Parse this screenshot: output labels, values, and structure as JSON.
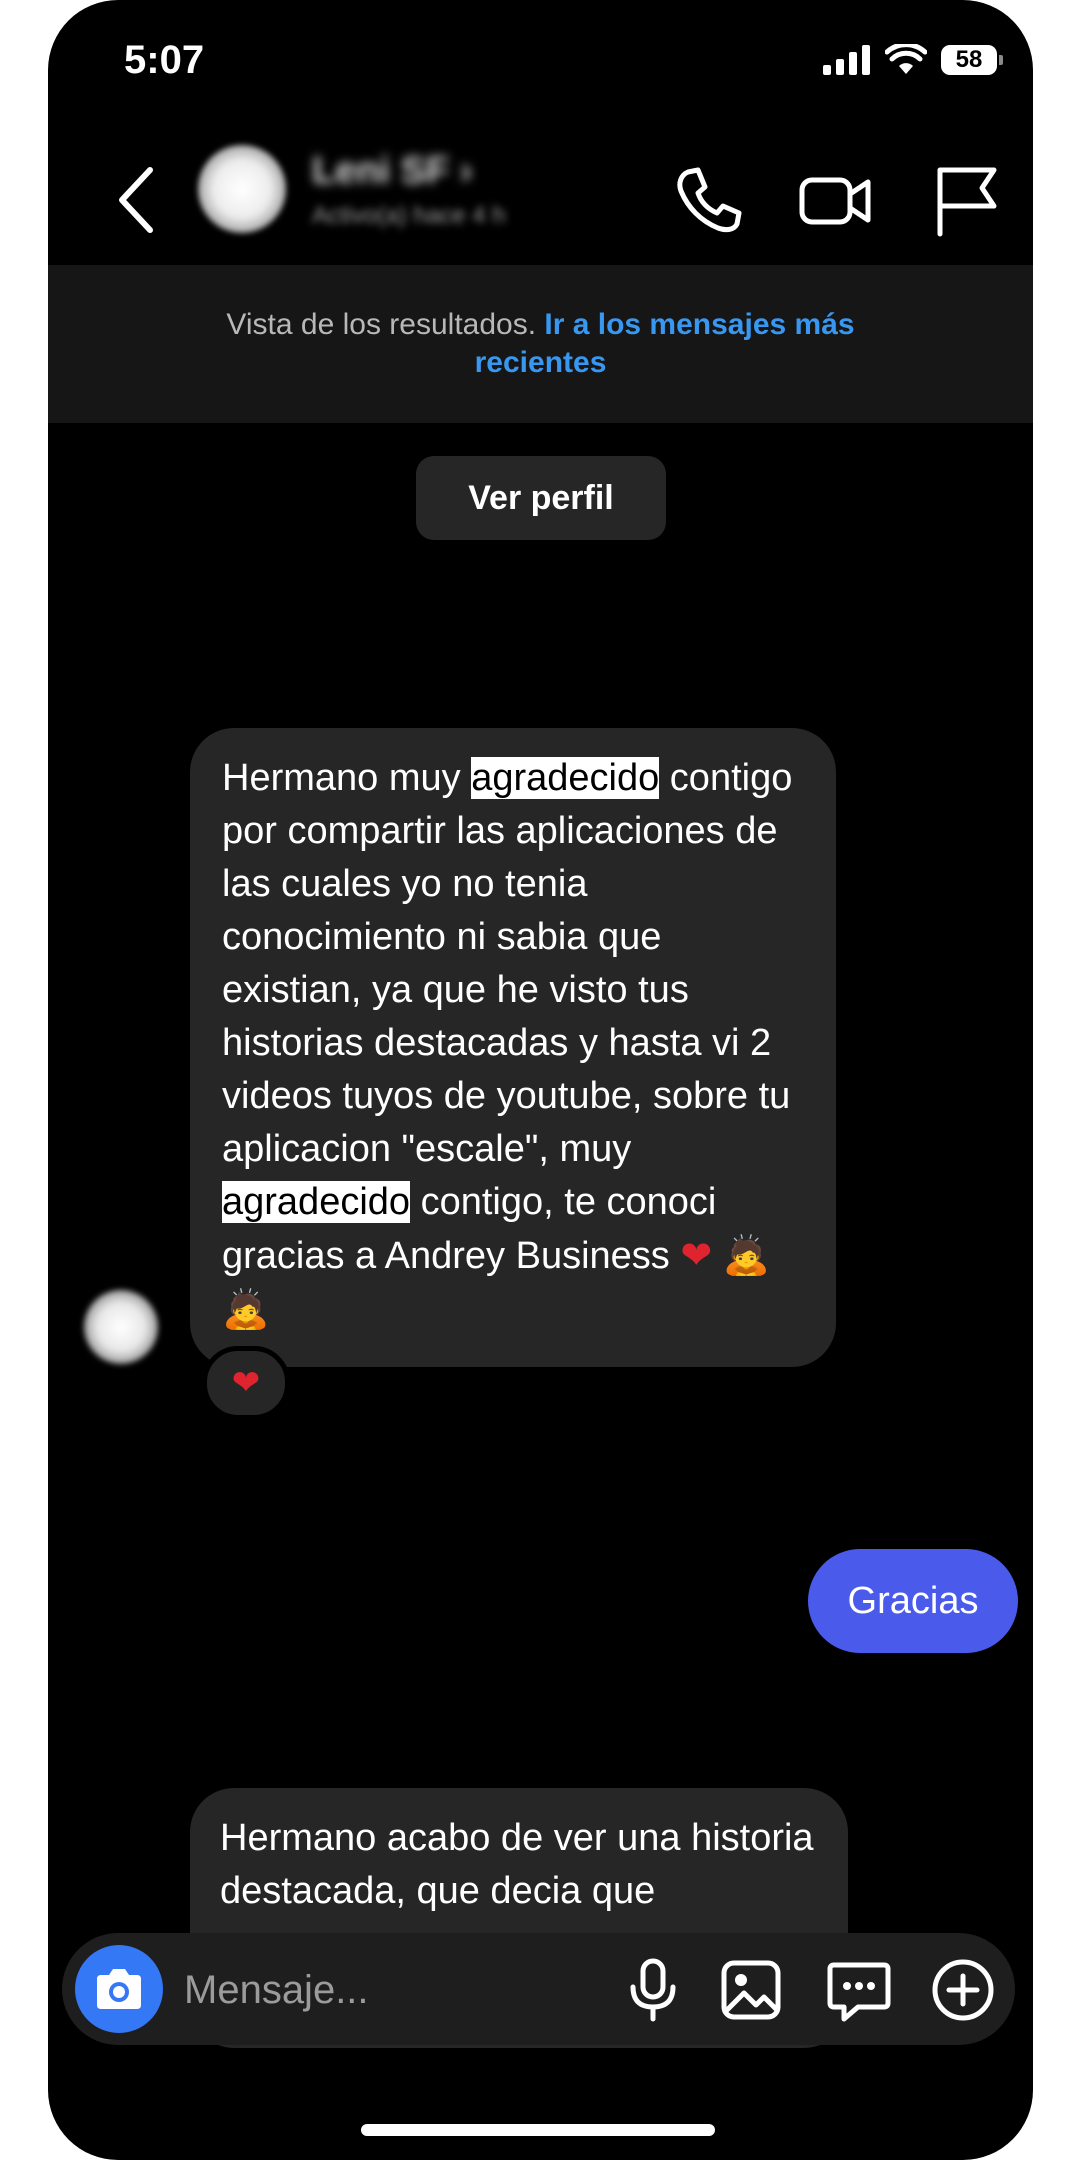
{
  "status_bar": {
    "time": "5:07",
    "battery": "58"
  },
  "header": {
    "contact_name": "Leni SF ›",
    "contact_subtitle": "Activo(a) hace 4 h"
  },
  "banner": {
    "text": "Vista de los resultados.",
    "link": "Ir a los mensajes más recientes"
  },
  "profile_button": "Ver perfil",
  "messages": {
    "m1": {
      "part1": "Hermano muy ",
      "highlight1": "agradecido",
      "part2": " contigo por compartir las aplicaciones de las cuales yo no tenia conocimiento ni sabia que existian, ya que he visto tus historias destacadas y hasta vi 2 videos tuyos de youtube, sobre tu aplicacion  \"escale\", muy ",
      "highlight2": "agradecido",
      "part3": " contigo, te conoci gracias a Andrey Business ",
      "emoji_heart": "❤",
      "emoji_monk1": "🙇",
      "emoji_monk2": "🙇",
      "reaction": "❤"
    },
    "m2": {
      "text": "Gracias"
    },
    "m3": {
      "text": "Hermano acabo de ver una historia destacada, que decia que"
    }
  },
  "composer": {
    "placeholder": "Mensaje..."
  },
  "colors": {
    "accent_link": "#3897f0",
    "outgoing_bubble": "#4a5bec",
    "camera_button": "#3478f6"
  }
}
